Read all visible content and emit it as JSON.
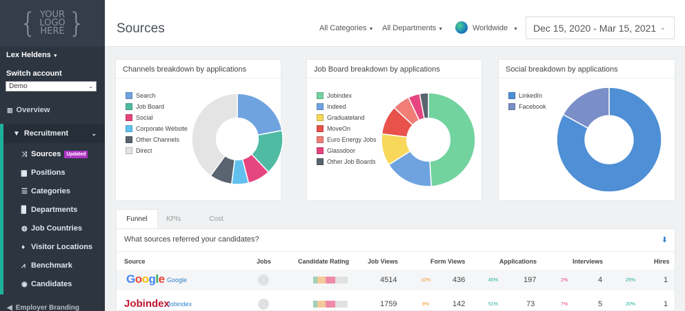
{
  "logo": {
    "line1": "YOUR",
    "line2": "LOGO",
    "line3": "HERE"
  },
  "sidebar": {
    "user": "Lex Heldens",
    "switch_label": "Switch account",
    "account_value": "Demo",
    "overview": "Overview",
    "recruitment": "Recruitment",
    "items": [
      {
        "label": "Sources",
        "badge": "Updated"
      },
      {
        "label": "Positions"
      },
      {
        "label": "Categories"
      },
      {
        "label": "Departments"
      },
      {
        "label": "Job Countries"
      },
      {
        "label": "Visitor Locations"
      },
      {
        "label": "Benchmark"
      },
      {
        "label": "Candidates"
      }
    ],
    "employer": "Employer Branding"
  },
  "header": {
    "title": "Sources",
    "categories": "All Categories",
    "departments": "All Departments",
    "region": "Worldwide",
    "date_range": "Dec 15, 2020 - Mar 15, 2021"
  },
  "cards": [
    {
      "title": "Channels breakdown by applications",
      "legend": [
        {
          "label": "Search",
          "color": "#6fa3e0"
        },
        {
          "label": "Job Board",
          "color": "#4fbba2"
        },
        {
          "label": "Social",
          "color": "#e5467f"
        },
        {
          "label": "Corporate Website",
          "color": "#62c0ee"
        },
        {
          "label": "Other Channels",
          "color": "#5a6470"
        },
        {
          "label": "Direct",
          "color": "#e4e4e4"
        }
      ],
      "slices": [
        0.22,
        0.16,
        0.08,
        0.06,
        0.08,
        0.4
      ]
    },
    {
      "title": "Job Board breakdown by applications",
      "legend": [
        {
          "label": "Jobindex",
          "color": "#72d39e"
        },
        {
          "label": "Indeed",
          "color": "#6fa3e0"
        },
        {
          "label": "Graduateland",
          "color": "#f7d85a"
        },
        {
          "label": "MoveOn",
          "color": "#e8524b"
        },
        {
          "label": "Euro Energy Jobs",
          "color": "#f07e77"
        },
        {
          "label": "Glassdoor",
          "color": "#e5467f"
        },
        {
          "label": "Other Job Boards",
          "color": "#5a6470"
        }
      ],
      "slices": [
        0.49,
        0.17,
        0.11,
        0.1,
        0.06,
        0.04,
        0.03
      ]
    },
    {
      "title": "Social breakdown by applications",
      "legend": [
        {
          "label": "LinkedIn",
          "color": "#4e8fd6"
        },
        {
          "label": "Facebook",
          "color": "#7a8fc7"
        }
      ],
      "slices": [
        0.83,
        0.17
      ]
    }
  ],
  "tabs": [
    "Funnel",
    "KPIs",
    "Cost"
  ],
  "table": {
    "heading": "What sources referred your candidates?",
    "headers": [
      "Source",
      "Jobs",
      "Candidate Rating",
      "Job Views",
      "Form Views",
      "Applications",
      "Interviews",
      "Hires"
    ],
    "rows": [
      {
        "logo": "Google",
        "name": "Google",
        "job_views": "4514",
        "form_pct": "10%",
        "form_views": "436",
        "app_pct": "45%",
        "applications": "197",
        "int_pct": "2%",
        "interviews": "4",
        "hire_pct": "25%",
        "hires": "1"
      },
      {
        "logo": "Jobindex",
        "name": "Jobindex",
        "job_views": "1759",
        "form_pct": "8%",
        "form_views": "142",
        "app_pct": "51%",
        "applications": "73",
        "int_pct": "7%",
        "interviews": "5",
        "hire_pct": "20%",
        "hires": "1"
      }
    ]
  },
  "colors": {
    "accent": "#1fb09a",
    "badge": "#b035c5",
    "link": "#2f7fc9",
    "pct_orange": "#f0962e",
    "pct_green": "#1fb09a",
    "pct_red": "#e5467f"
  }
}
